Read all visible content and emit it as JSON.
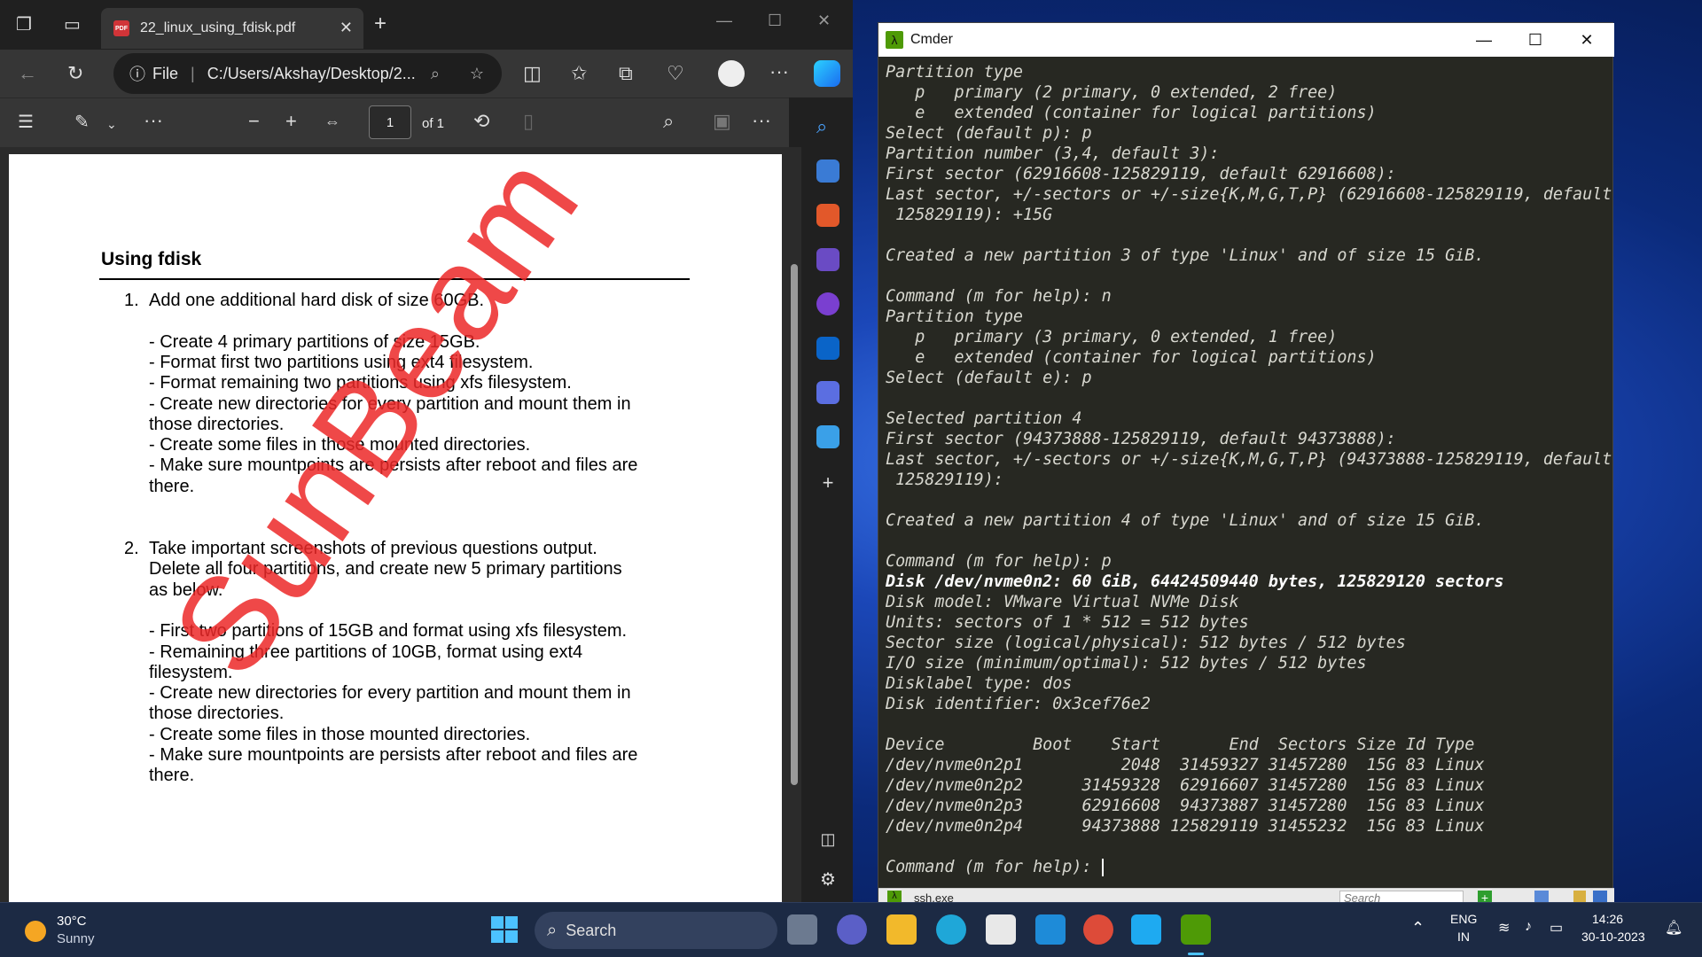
{
  "edge": {
    "tab_title": "22_linux_using_fdisk.pdf",
    "pdf_badge": "PDF",
    "address_scheme": "File",
    "address": "C:/Users/Akshay/Desktop/2...",
    "page_current": "1",
    "page_total": "of 1"
  },
  "document": {
    "heading": "Using fdisk",
    "items": [
      {
        "num": "1.",
        "lines": [
          "Add one additional hard disk of size 60GB.",
          "",
          "- Create 4 primary partitions of size 15GB.",
          "- Format first two partitions using ext4 filesystem.",
          "- Format remaining two partitions using xfs filesystem.",
          "- Create new directories for every partition and mount them in",
          "those directories.",
          "- Create some files in those mounted directories.",
          "- Make sure mountpoints are persists after reboot and files are",
          "there."
        ]
      },
      {
        "num": "2.",
        "lines": [
          "Take important screenshots of previous questions output.",
          "Delete all four partitions, and create new 5 primary partitions",
          "as below.",
          "",
          "- First two partitions of 15GB and format using xfs filesystem.",
          "- Remaining three partitions of 10GB, format using ext4",
          "filesystem.",
          "- Create new directories for every partition and mount them in",
          "those directories.",
          "- Create some files in those mounted directories.",
          "- Make sure mountpoints are persists after reboot and files are",
          "there."
        ]
      }
    ],
    "watermark": "SunBeam"
  },
  "cmder": {
    "title": "Cmder",
    "lines": [
      "Partition type",
      "   p   primary (2 primary, 0 extended, 2 free)",
      "   e   extended (container for logical partitions)",
      "Select (default p): p",
      "Partition number (3,4, default 3):",
      "First sector (62916608-125829119, default 62916608):",
      "Last sector, +/-sectors or +/-size{K,M,G,T,P} (62916608-125829119, default",
      " 125829119): +15G",
      "",
      "Created a new partition 3 of type 'Linux' and of size 15 GiB.",
      "",
      "Command (m for help): n",
      "Partition type",
      "   p   primary (3 primary, 0 extended, 1 free)",
      "   e   extended (container for logical partitions)",
      "Select (default e): p",
      "",
      "Selected partition 4",
      "First sector (94373888-125829119, default 94373888):",
      "Last sector, +/-sectors or +/-size{K,M,G,T,P} (94373888-125829119, default",
      " 125829119):",
      "",
      "Created a new partition 4 of type 'Linux' and of size 15 GiB.",
      "",
      "Command (m for help): p",
      "Disk /dev/nvme0n2: 60 GiB, 64424509440 bytes, 125829120 sectors",
      "Disk model: VMware Virtual NVMe Disk",
      "Units: sectors of 1 * 512 = 512 bytes",
      "Sector size (logical/physical): 512 bytes / 512 bytes",
      "I/O size (minimum/optimal): 512 bytes / 512 bytes",
      "Disklabel type: dos",
      "Disk identifier: 0x3cef76e2",
      "",
      "Device         Boot    Start       End  Sectors Size Id Type",
      "/dev/nvme0n2p1          2048  31459327 31457280  15G 83 Linux",
      "/dev/nvme0n2p2      31459328  62916607 31457280  15G 83 Linux",
      "/dev/nvme0n2p3      62916608  94373887 31457280  15G 83 Linux",
      "/dev/nvme0n2p4      94373888 125829119 31455232  15G 83 Linux",
      "",
      "Command (m for help): "
    ],
    "bold_line": 25,
    "status_tab": "ssh.exe",
    "status_search": "Search"
  },
  "taskbar": {
    "weather_temp": "30°C",
    "weather_desc": "Sunny",
    "search": "Search",
    "lang": "ENG",
    "region": "IN",
    "time": "14:26",
    "date": "30-10-2023"
  },
  "colors": {
    "terminal_bg": "#272822",
    "watermark": "#ec2828",
    "edge_dark": "#202020"
  }
}
